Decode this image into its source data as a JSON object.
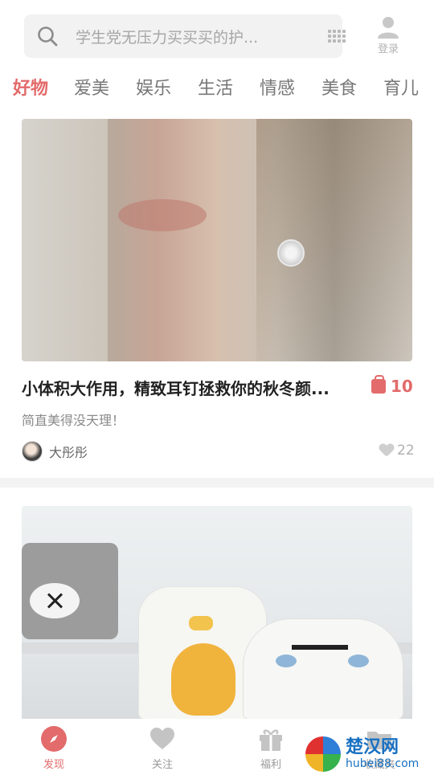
{
  "search": {
    "placeholder": "学生党无压力买买买的护..."
  },
  "header": {
    "login_label": "登录"
  },
  "tabs": [
    {
      "label": "好物",
      "active": true
    },
    {
      "label": "爱美",
      "active": false
    },
    {
      "label": "娱乐",
      "active": false
    },
    {
      "label": "生活",
      "active": false
    },
    {
      "label": "情感",
      "active": false
    },
    {
      "label": "美食",
      "active": false
    },
    {
      "label": "育儿",
      "active": false
    }
  ],
  "cards": [
    {
      "title": "小体积大作用，精致耳钉拯救你的秋冬颜...",
      "subtitle": "简直美得没天理！",
      "product_count": "10",
      "author": "大彤彤",
      "likes": "22"
    }
  ],
  "bottom_nav": [
    {
      "label": "发现",
      "icon": "compass-icon",
      "active": true
    },
    {
      "label": "关注",
      "icon": "heart-icon",
      "active": false
    },
    {
      "label": "福利",
      "icon": "gift-icon",
      "active": false
    },
    {
      "label": "收藏夹",
      "icon": "folder-icon",
      "active": false
    }
  ],
  "watermark": {
    "text": "楚汉网",
    "url": "hubei88.com"
  },
  "colors": {
    "accent": "#e36b6b",
    "muted": "#999999",
    "search_bg": "#f2f2f2"
  }
}
